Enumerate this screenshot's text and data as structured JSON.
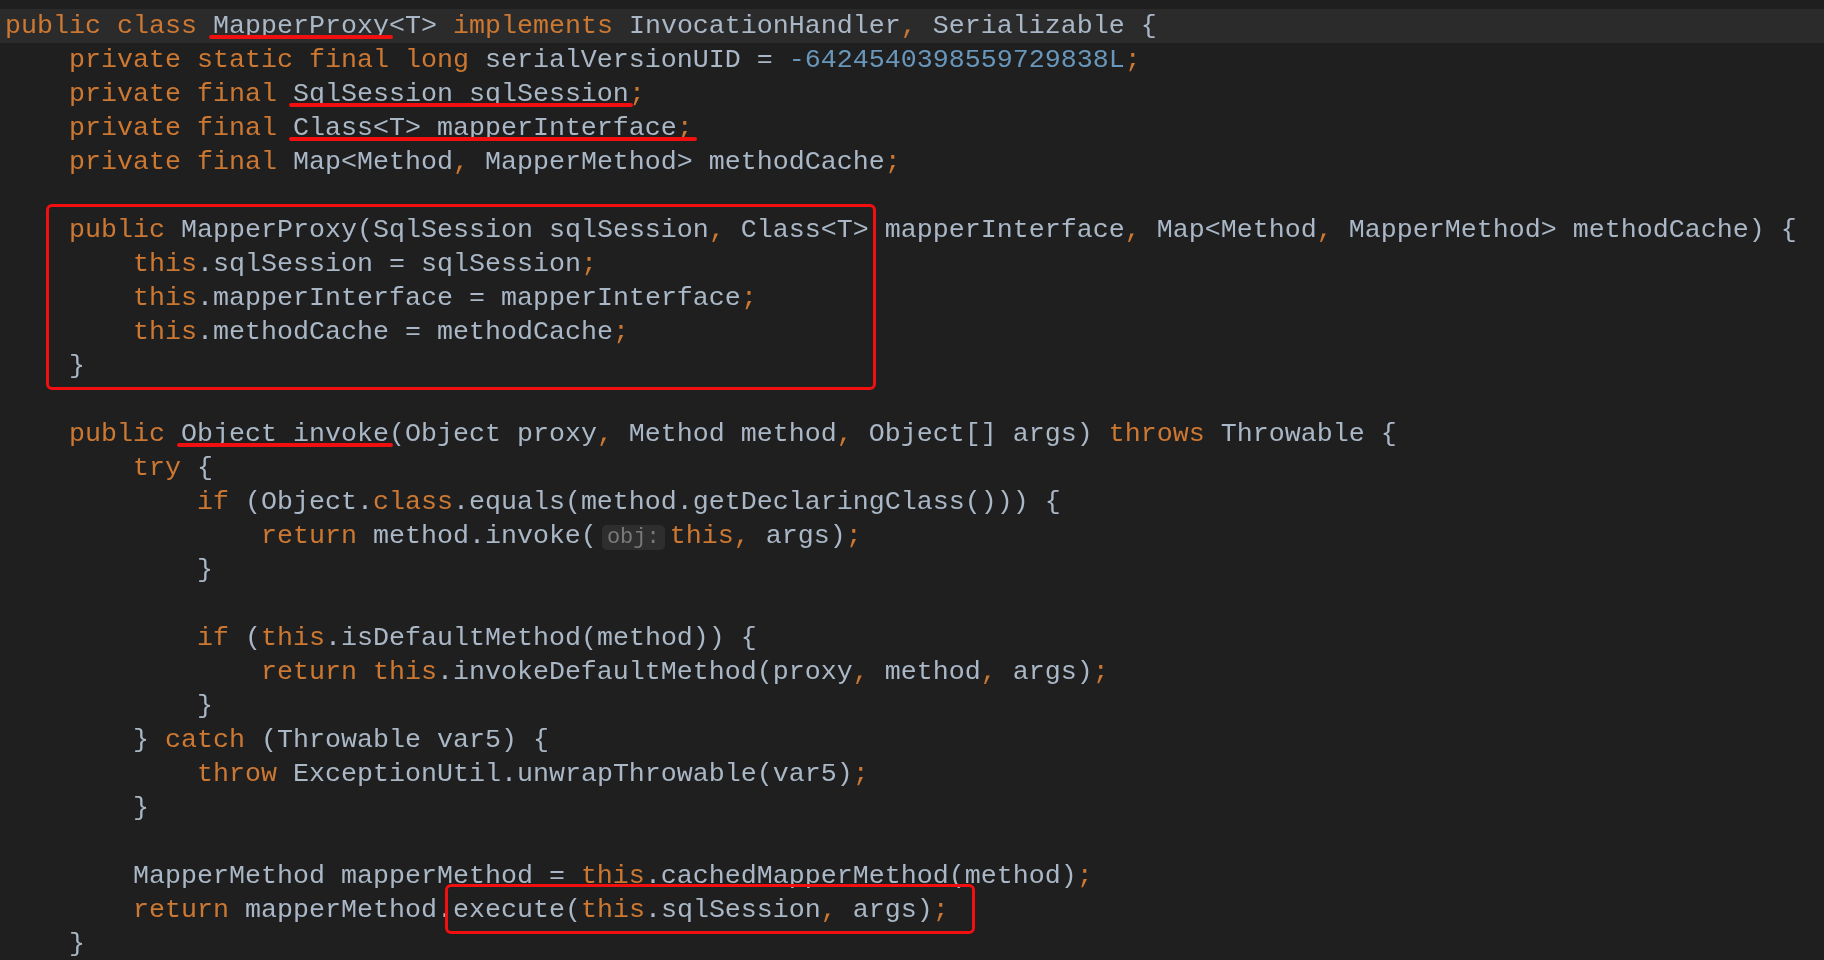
{
  "editor": {
    "lines": [
      {
        "kind": "code",
        "current": true,
        "tokens": [
          {
            "kind": "keyword",
            "text": "public class "
          },
          {
            "kind": "plain",
            "text": "MapperProxy",
            "underlined": true
          },
          {
            "kind": "plain",
            "text": "<T> "
          },
          {
            "kind": "keyword",
            "text": "implements"
          },
          {
            "kind": "plain",
            "text": " InvocationHandler"
          },
          {
            "kind": "keyword",
            "text": ","
          },
          {
            "kind": "plain",
            "text": " Serializable {"
          }
        ]
      },
      {
        "kind": "code",
        "current": false,
        "tokens": [
          {
            "kind": "keyword",
            "text": "    private static final long "
          },
          {
            "kind": "plain",
            "text": "serialVersionUID = "
          },
          {
            "kind": "number",
            "text": "-6424540398559729838L"
          },
          {
            "kind": "keyword",
            "text": ";"
          }
        ]
      },
      {
        "kind": "code",
        "current": false,
        "tokens": [
          {
            "kind": "keyword",
            "text": "    private final "
          },
          {
            "kind": "plain",
            "text": "SqlSession sqlSession",
            "underlined": true
          },
          {
            "kind": "keyword",
            "text": ";"
          }
        ]
      },
      {
        "kind": "code",
        "current": false,
        "tokens": [
          {
            "kind": "keyword",
            "text": "    private final "
          },
          {
            "kind": "plain",
            "text": "Class<T> mapperInterface",
            "underlined": true
          },
          {
            "kind": "keyword",
            "text": ";",
            "underlined": true
          }
        ]
      },
      {
        "kind": "code",
        "current": false,
        "tokens": [
          {
            "kind": "keyword",
            "text": "    private final "
          },
          {
            "kind": "plain",
            "text": "Map<Method"
          },
          {
            "kind": "keyword",
            "text": ","
          },
          {
            "kind": "plain",
            "text": " MapperMethod> methodCache"
          },
          {
            "kind": "keyword",
            "text": ";"
          }
        ]
      },
      {
        "kind": "blank"
      },
      {
        "kind": "box",
        "lines": [
          {
            "current": false,
            "tokens": [
              {
                "kind": "keyword",
                "text": "public"
              },
              {
                "kind": "plain",
                "text": " MapperProxy(SqlSession sqlSession"
              },
              {
                "kind": "keyword",
                "text": ","
              },
              {
                "kind": "plain",
                "text": " Class<T>"
              }
            ]
          },
          {
            "current": false,
            "tokens": [
              {
                "kind": "keyword",
                "text": "    this"
              },
              {
                "kind": "plain",
                "text": ".sqlSession = sqlSession"
              },
              {
                "kind": "keyword",
                "text": ";"
              }
            ]
          },
          {
            "current": false,
            "tokens": [
              {
                "kind": "keyword",
                "text": "    this"
              },
              {
                "kind": "plain",
                "text": ".mapperInterface = mapperInterface"
              },
              {
                "kind": "keyword",
                "text": ";"
              }
            ]
          },
          {
            "current": false,
            "tokens": [
              {
                "kind": "keyword",
                "text": "    this"
              },
              {
                "kind": "plain",
                "text": ".methodCache = methodCache"
              },
              {
                "kind": "keyword",
                "text": ";"
              }
            ]
          },
          {
            "current": false,
            "tokens": [
              {
                "kind": "plain",
                "text": "}"
              }
            ]
          }
        ],
        "after": [
          {
            "kind": "plain",
            "text": " mapperInterface"
          },
          {
            "kind": "keyword",
            "text": ","
          },
          {
            "kind": "plain",
            "text": " Map<Method"
          },
          {
            "kind": "keyword",
            "text": ","
          },
          {
            "kind": "plain",
            "text": " MapperMethod> methodCache) {"
          }
        ]
      },
      {
        "kind": "blank"
      },
      {
        "kind": "code",
        "current": false,
        "tokens": [
          {
            "kind": "keyword",
            "text": "    public "
          },
          {
            "kind": "plain",
            "text": "Object invoke",
            "underlined": true
          },
          {
            "kind": "plain",
            "text": "(Object proxy"
          },
          {
            "kind": "keyword",
            "text": ","
          },
          {
            "kind": "plain",
            "text": " Method method"
          },
          {
            "kind": "keyword",
            "text": ","
          },
          {
            "kind": "plain",
            "text": " Object[] args) "
          },
          {
            "kind": "keyword",
            "text": "throws"
          },
          {
            "kind": "plain",
            "text": " Throwable {"
          }
        ]
      },
      {
        "kind": "code",
        "current": false,
        "tokens": [
          {
            "kind": "keyword",
            "text": "        try"
          },
          {
            "kind": "plain",
            "text": " {"
          }
        ]
      },
      {
        "kind": "code",
        "current": false,
        "tokens": [
          {
            "kind": "keyword",
            "text": "            if"
          },
          {
            "kind": "plain",
            "text": " (Object."
          },
          {
            "kind": "keyword",
            "text": "class"
          },
          {
            "kind": "plain",
            "text": ".equals(method.getDeclaringClass())) {"
          }
        ]
      },
      {
        "kind": "code",
        "current": false,
        "tokens": [
          {
            "kind": "keyword",
            "text": "                return"
          },
          {
            "kind": "plain",
            "text": " method.invoke("
          },
          {
            "kind": "hint",
            "text": "obj:"
          },
          {
            "kind": "keyword",
            "text": "this"
          },
          {
            "kind": "keyword",
            "text": ","
          },
          {
            "kind": "plain",
            "text": " args)"
          },
          {
            "kind": "keyword",
            "text": ";"
          }
        ]
      },
      {
        "kind": "code",
        "current": false,
        "tokens": [
          {
            "kind": "plain",
            "text": "            }"
          }
        ]
      },
      {
        "kind": "blank"
      },
      {
        "kind": "code",
        "current": false,
        "tokens": [
          {
            "kind": "keyword",
            "text": "            if"
          },
          {
            "kind": "plain",
            "text": " ("
          },
          {
            "kind": "keyword",
            "text": "this"
          },
          {
            "kind": "plain",
            "text": ".isDefaultMethod(method)) {"
          }
        ]
      },
      {
        "kind": "code",
        "current": false,
        "tokens": [
          {
            "kind": "keyword",
            "text": "                return this"
          },
          {
            "kind": "plain",
            "text": ".invokeDefaultMethod(proxy"
          },
          {
            "kind": "keyword",
            "text": ","
          },
          {
            "kind": "plain",
            "text": " method"
          },
          {
            "kind": "keyword",
            "text": ","
          },
          {
            "kind": "plain",
            "text": " args)"
          },
          {
            "kind": "keyword",
            "text": ";"
          }
        ]
      },
      {
        "kind": "code",
        "current": false,
        "tokens": [
          {
            "kind": "plain",
            "text": "            }"
          }
        ]
      },
      {
        "kind": "code",
        "current": false,
        "tokens": [
          {
            "kind": "plain",
            "text": "        } "
          },
          {
            "kind": "keyword",
            "text": "catch"
          },
          {
            "kind": "plain",
            "text": " (Throwable var5) {"
          }
        ]
      },
      {
        "kind": "code",
        "current": false,
        "tokens": [
          {
            "kind": "keyword",
            "text": "            throw"
          },
          {
            "kind": "plain",
            "text": " ExceptionUtil.unwrapThrowable(var5)"
          },
          {
            "kind": "keyword",
            "text": ";"
          }
        ]
      },
      {
        "kind": "code",
        "current": false,
        "tokens": [
          {
            "kind": "plain",
            "text": "        }"
          }
        ]
      },
      {
        "kind": "blank"
      },
      {
        "kind": "code",
        "current": false,
        "tokens": [
          {
            "kind": "plain",
            "text": "        MapperMethod mapperMethod = "
          },
          {
            "kind": "keyword",
            "text": "this"
          },
          {
            "kind": "plain",
            "text": ".cachedMapperMethod(method)"
          },
          {
            "kind": "keyword",
            "text": ";"
          }
        ]
      },
      {
        "kind": "box",
        "before": [
          {
            "kind": "keyword",
            "text": "        return"
          },
          {
            "kind": "plain",
            "text": " mapperMethod."
          }
        ],
        "lines": [
          {
            "current": false,
            "tokens": [
              {
                "kind": "plain",
                "text": "execute("
              },
              {
                "kind": "keyword",
                "text": "this"
              },
              {
                "kind": "plain",
                "text": ".sqlSession"
              },
              {
                "kind": "keyword",
                "text": ","
              },
              {
                "kind": "plain",
                "text": " args)"
              },
              {
                "kind": "keyword",
                "text": ";"
              }
            ]
          }
        ]
      },
      {
        "kind": "code",
        "current": false,
        "tokens": [
          {
            "kind": "plain",
            "text": "    }"
          }
        ]
      }
    ]
  }
}
